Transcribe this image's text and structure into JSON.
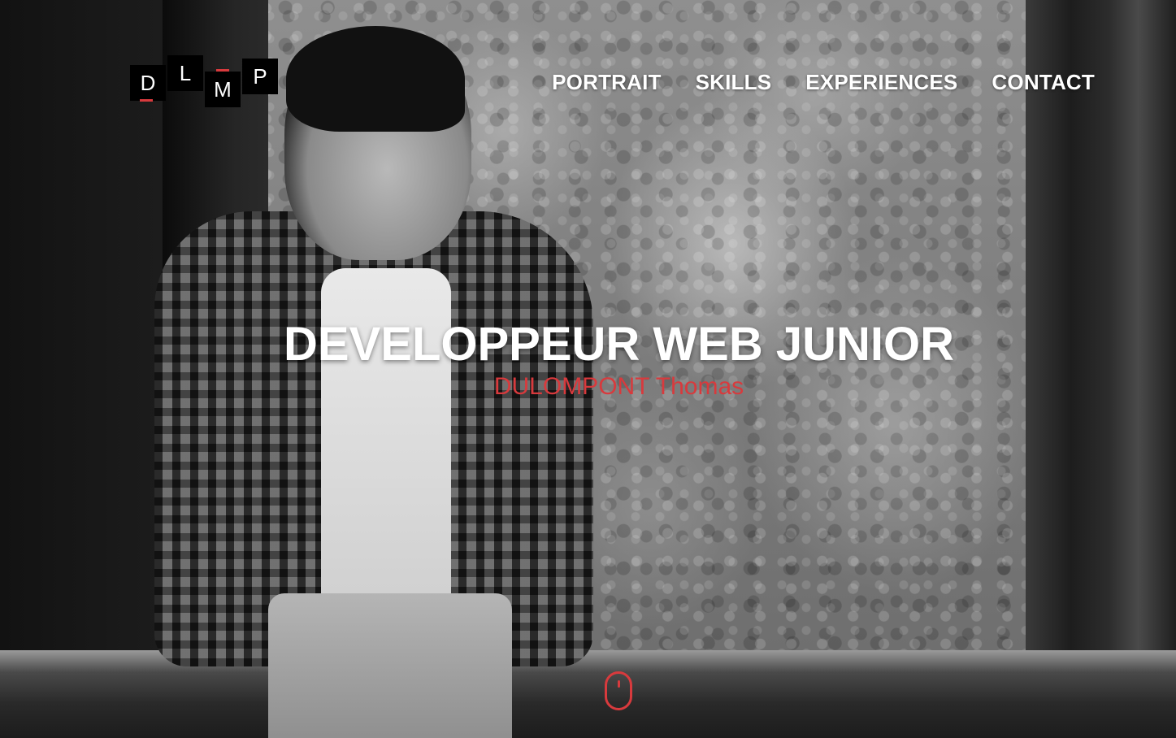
{
  "logo": {
    "letters": [
      "D",
      "L",
      "M",
      "P"
    ],
    "accent_color": "#d83a3d"
  },
  "nav": {
    "items": [
      {
        "label": "PORTRAIT"
      },
      {
        "label": "SKILLS"
      },
      {
        "label": "EXPERIENCES"
      },
      {
        "label": "CONTACT"
      }
    ]
  },
  "hero": {
    "title": "DEVELOPPEUR WEB JUNIOR",
    "subtitle": "DULOMPONT Thomas",
    "subtitle_color": "#d83a3d",
    "scroll_icon": "mouse-scroll-icon"
  }
}
